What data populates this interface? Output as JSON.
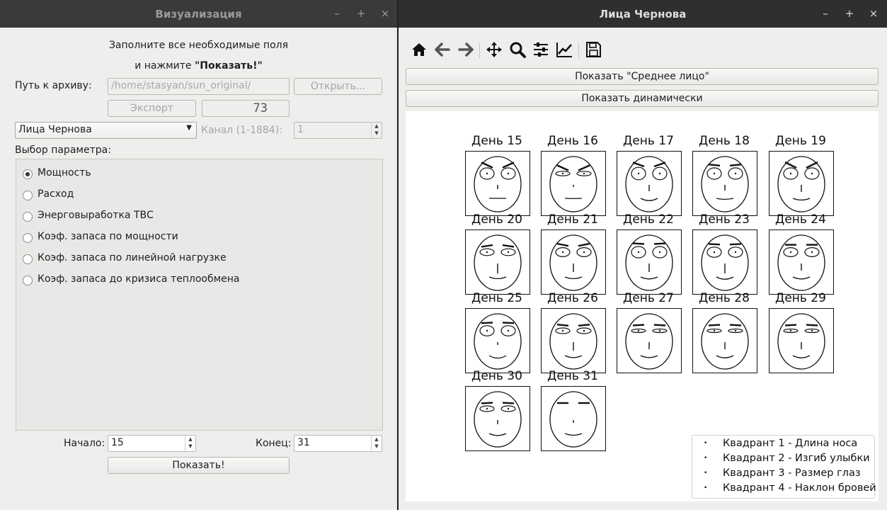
{
  "left_window": {
    "title": "Визуализация",
    "controls": {
      "minimize": "–",
      "maximize": "+",
      "close": "×"
    },
    "instructions_line1": "Заполните все необходимые поля",
    "instructions_line2_prefix": "и нажмите ",
    "instructions_line2_bold": "\"Показать!\"",
    "archive_label": "Путь к архиву:",
    "archive_path": "/home/stasyan/sun_original/",
    "open_button": "Открыть...",
    "export_button": "Экспорт",
    "lcd_value": "73",
    "method_select": "Лица Чернова",
    "channel_label": "Канал (1-1884):",
    "channel_value": "1",
    "param_label": "Выбор параметра:",
    "params": [
      {
        "label": "Мощность",
        "checked": true
      },
      {
        "label": "Расход",
        "checked": false
      },
      {
        "label": "Энерговыработка ТВС",
        "checked": false
      },
      {
        "label": "Коэф. запаса по мощности",
        "checked": false
      },
      {
        "label": "Коэф. запаса по линейной нагрузке",
        "checked": false
      },
      {
        "label": "Коэф. запаса до кризиса теплообмена",
        "checked": false
      }
    ],
    "start_label": "Начало:",
    "start_value": "15",
    "end_label": "Конец:",
    "end_value": "31",
    "show_button": "Показать!"
  },
  "right_window": {
    "title": "Лица Чернова",
    "controls": {
      "minimize": "–",
      "maximize": "+",
      "close": "×"
    },
    "toolbar": [
      "home-icon",
      "back-icon",
      "forward-icon",
      "pan-icon",
      "zoom-icon",
      "configure-subplots-icon",
      "edit-axis-icon",
      "save-icon"
    ],
    "show_mean_button": "Показать \"Среднее лицо\"",
    "show_dynamic_button": "Показать динамически",
    "faces": [
      {
        "label": "День 15",
        "eye": 10,
        "pupil": 1,
        "brow": 0.45,
        "smile": 0.0,
        "nose": 6
      },
      {
        "label": "День 16",
        "eye": 4,
        "pupil": 1,
        "brow": 0.45,
        "smile": 0.1,
        "nose": 3
      },
      {
        "label": "День 17",
        "eye": 11,
        "pupil": 1,
        "brow": 0.35,
        "smile": 0.8,
        "nose": 9
      },
      {
        "label": "День 18",
        "eye": 10,
        "pupil": 1,
        "brow": 0.1,
        "smile": 0.35,
        "nose": 8
      },
      {
        "label": "День 19",
        "eye": 10,
        "pupil": 1,
        "brow": 0.5,
        "smile": 0.6,
        "nose": 10
      },
      {
        "label": "День 20",
        "eye": 6,
        "pupil": 1,
        "brow": -0.15,
        "smile": 0.6,
        "nose": 14
      },
      {
        "label": "День 21",
        "eye": 8,
        "pupil": 1,
        "brow": 0.2,
        "smile": 0.6,
        "nose": 12
      },
      {
        "label": "День 22",
        "eye": 10,
        "pupil": 1,
        "brow": 0.05,
        "smile": 0.7,
        "nose": 12
      },
      {
        "label": "День 23",
        "eye": 9,
        "pupil": 1,
        "brow": 0.05,
        "smile": 0.8,
        "nose": 14
      },
      {
        "label": "День 24",
        "eye": 8,
        "pupil": 1,
        "brow": 0.0,
        "smile": 0.7,
        "nose": 10
      },
      {
        "label": "День 25",
        "eye": 9,
        "pupil": 1,
        "brow": -0.05,
        "smile": 0.9,
        "nose": 4
      },
      {
        "label": "День 26",
        "eye": 5,
        "pupil": 1,
        "brow": 0.1,
        "smile": 0.7,
        "nose": 12
      },
      {
        "label": "День 27",
        "eye": 3,
        "pupil": 1,
        "brow": -0.05,
        "smile": 0.7,
        "nose": 10
      },
      {
        "label": "День 28",
        "eye": 3,
        "pupil": 1,
        "brow": -0.05,
        "smile": 0.8,
        "nose": 10
      },
      {
        "label": "День 29",
        "eye": 2,
        "pupil": 1,
        "brow": -0.05,
        "smile": 0.8,
        "nose": 10
      },
      {
        "label": "День 30",
        "eye": 5,
        "pupil": 1,
        "brow": -0.05,
        "smile": 0.7,
        "nose": 6
      },
      {
        "label": "День 31",
        "eye": 0,
        "pupil": 0,
        "brow": 0.0,
        "smile": 0.6,
        "nose": 4
      }
    ],
    "legend": [
      "Квадрант 1 - Длина носа",
      "Квадрант 2 - Изгиб улыбки",
      "Квадрант 3 - Размер глаз",
      "Квадрант 4 - Наклон бровей"
    ],
    "legend_bullet": "•"
  }
}
